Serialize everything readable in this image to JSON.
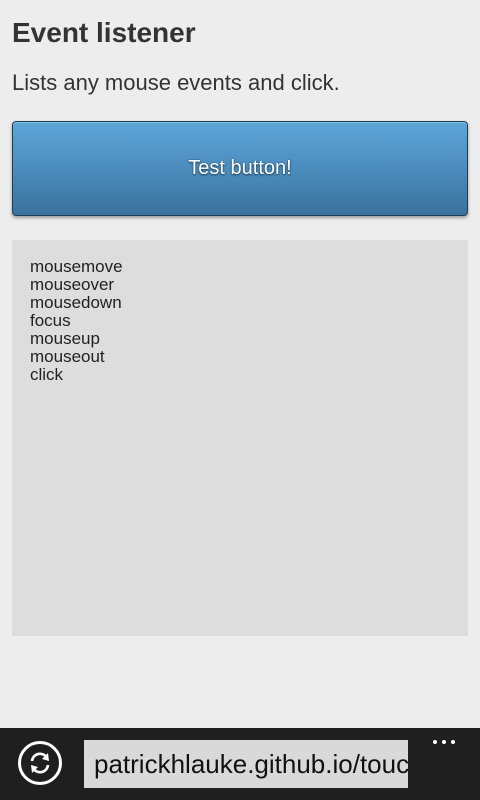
{
  "header": {
    "title": "Event listener",
    "subtitle": "Lists any mouse events and click."
  },
  "test_button": {
    "label": "Test button!"
  },
  "event_log": {
    "entries": [
      "mousemove",
      "mouseover",
      "mousedown",
      "focus",
      "mouseup",
      "mouseout",
      "click"
    ]
  },
  "browser_bar": {
    "address": "patrickhlauke.github.io/touc",
    "refresh_icon": "refresh-icon",
    "more_icon": "more-icon"
  },
  "colors": {
    "page_background": "#ededed",
    "button_top": "#5ea6d8",
    "button_bottom": "#3a729c",
    "log_background": "#dddddd",
    "bar_background": "#1f1f1f"
  }
}
